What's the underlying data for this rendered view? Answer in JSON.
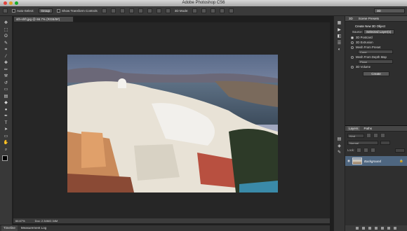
{
  "window": {
    "title": "Adobe Photoshop CS6"
  },
  "options_bar": {
    "auto_select_label": "Auto-Select:",
    "auto_select_value": "Group",
    "show_transform_label": "Show Transform Controls",
    "mode_label": "3D Mode:",
    "workspace_value": "3D"
  },
  "toolbox": {
    "tools": [
      {
        "name": "move-tool-icon",
        "glyph": "✥"
      },
      {
        "name": "marquee-tool-icon",
        "glyph": "⬚"
      },
      {
        "name": "lasso-tool-icon",
        "glyph": "ʘ"
      },
      {
        "name": "quick-select-tool-icon",
        "glyph": "✎"
      },
      {
        "name": "crop-tool-icon",
        "glyph": "⌗"
      },
      {
        "name": "eyedropper-tool-icon",
        "glyph": "⁄"
      },
      {
        "name": "healing-tool-icon",
        "glyph": "✚"
      },
      {
        "name": "brush-tool-icon",
        "glyph": "✏"
      },
      {
        "name": "stamp-tool-icon",
        "glyph": "⚒"
      },
      {
        "name": "history-brush-tool-icon",
        "glyph": "↺"
      },
      {
        "name": "eraser-tool-icon",
        "glyph": "▭"
      },
      {
        "name": "gradient-tool-icon",
        "glyph": "▤"
      },
      {
        "name": "blur-tool-icon",
        "glyph": "◆"
      },
      {
        "name": "dodge-tool-icon",
        "glyph": "●"
      },
      {
        "name": "pen-tool-icon",
        "glyph": "✒"
      },
      {
        "name": "type-tool-icon",
        "glyph": "T"
      },
      {
        "name": "path-select-tool-icon",
        "glyph": "➤"
      },
      {
        "name": "shape-tool-icon",
        "glyph": "▭"
      },
      {
        "name": "hand-tool-icon",
        "glyph": "✋"
      },
      {
        "name": "zoom-tool-icon",
        "glyph": "⌕"
      }
    ]
  },
  "document": {
    "tab_label": "sth-shft.jpg @ 66.7% (RGB/8#)",
    "zoom": "66.67%",
    "doc_size": "Doc: 2.34M/2.34M"
  },
  "bottom_tabs": [
    "Timeline",
    "Measurement Log"
  ],
  "scene_panel": {
    "tab": "3D",
    "header_label": "Scene Presets",
    "create_label": "Create New 3D Object",
    "source_label": "Source:",
    "source_value": "Selected Layer(s)",
    "options": [
      {
        "label": "3D Postcard",
        "selected": true
      },
      {
        "label": "3D Extrusion",
        "selected": false
      },
      {
        "label": "Mesh From Preset",
        "selected": false
      },
      {
        "label": "Mesh From Depth Map",
        "selected": false
      },
      {
        "label": "3D Volume",
        "selected": false
      }
    ],
    "preset_value": "Cone",
    "depth_value": "Plane",
    "create_button": "Create"
  },
  "layers_panel": {
    "tabs": [
      "Layers",
      "Paths"
    ],
    "kind_label": "Kind",
    "mode_value": "Normal",
    "lock_label": "Lock:",
    "layer_name": "Background"
  }
}
